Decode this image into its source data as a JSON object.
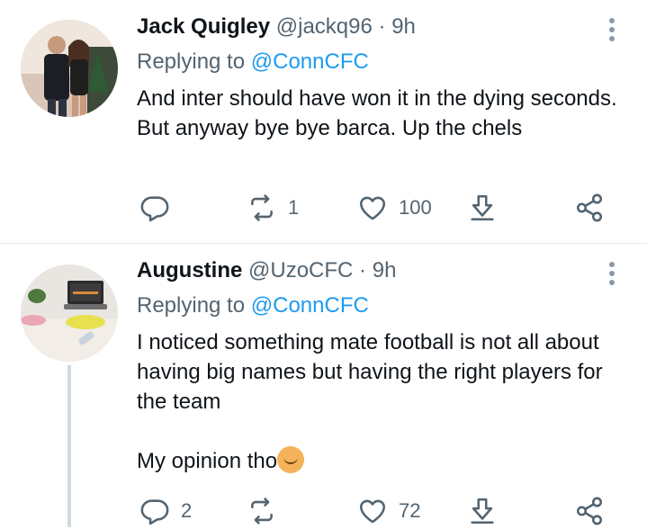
{
  "tweets": [
    {
      "name": "Jack Quigley",
      "handle": "@jackq96",
      "dot": "·",
      "time": "9h",
      "replying_prefix": "Replying to",
      "replying_to": "@ConnCFC",
      "body_lines": [
        "And inter should have won it in the dying seconds. But anyway bye bye barca. Up the chels"
      ],
      "replies": "",
      "retweets": "1",
      "likes": "100"
    },
    {
      "name": "Augustine",
      "handle": "@UzoCFC",
      "dot": "·",
      "time": "9h",
      "replying_prefix": "Replying to",
      "replying_to": "@ConnCFC",
      "body_lines": [
        "I noticed something mate football is not all about having big names but having the right players for the team",
        "My opinion tho"
      ],
      "replies": "2",
      "retweets": "",
      "likes": "72"
    }
  ],
  "icons": {
    "reply": "reply-icon",
    "retweet": "retweet-icon",
    "like": "heart-icon",
    "download": "download-icon",
    "share": "share-icon",
    "more": "more-icon",
    "emoji": "person-shrugging-emoji"
  },
  "colors": {
    "text": "#0f1419",
    "secondary": "#536471",
    "link": "#1d9bf0",
    "divider": "#e6ecf0"
  }
}
